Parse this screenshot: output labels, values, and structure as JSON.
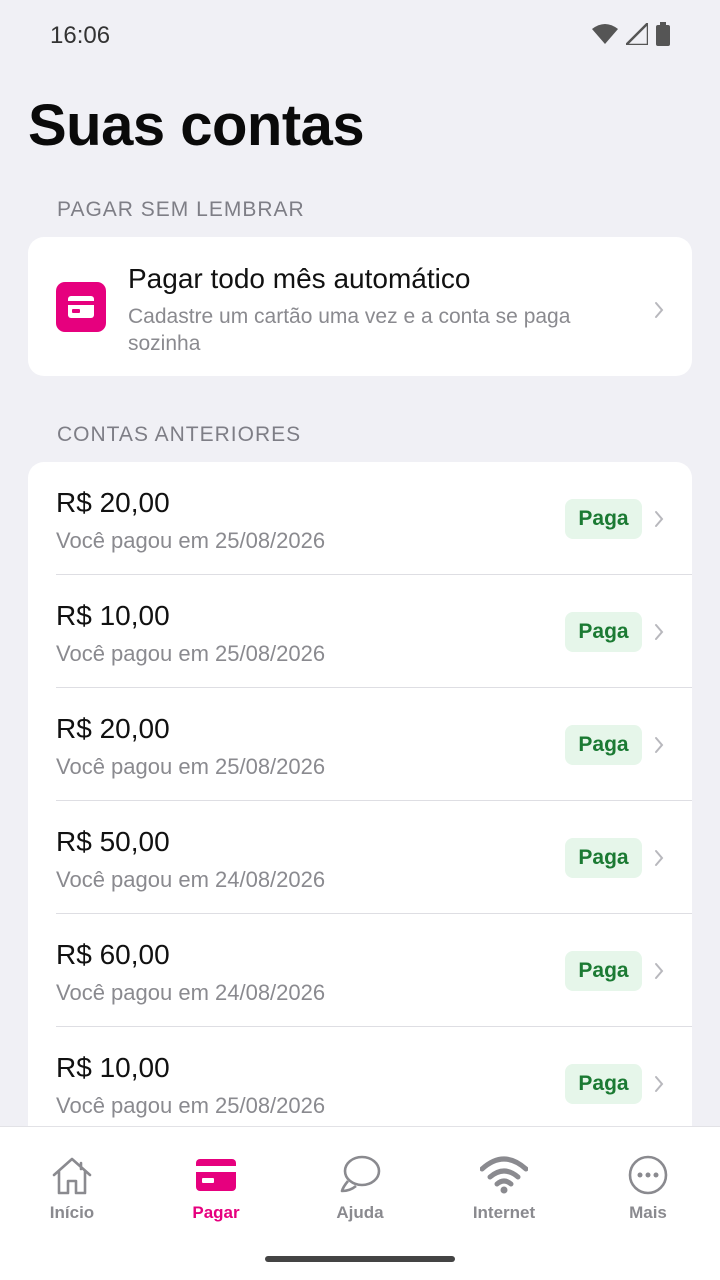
{
  "status_bar": {
    "time": "16:06"
  },
  "page": {
    "title": "Suas contas"
  },
  "autopay_section": {
    "label": "PAGAR SEM LEMBRAR",
    "card": {
      "title": "Pagar todo mês automático",
      "subtitle": "Cadastre um cartão uma vez e a conta se paga sozinha"
    }
  },
  "history_section": {
    "label": "CONTAS ANTERIORES",
    "bills": [
      {
        "amount": "R$ 20,00",
        "date": "Você pagou em 25/08/2026",
        "status": "Paga"
      },
      {
        "amount": "R$ 10,00",
        "date": "Você pagou em 25/08/2026",
        "status": "Paga"
      },
      {
        "amount": "R$ 20,00",
        "date": "Você pagou em 25/08/2026",
        "status": "Paga"
      },
      {
        "amount": "R$ 50,00",
        "date": "Você pagou em 24/08/2026",
        "status": "Paga"
      },
      {
        "amount": "R$ 60,00",
        "date": "Você pagou em 24/08/2026",
        "status": "Paga"
      },
      {
        "amount": "R$ 10,00",
        "date": "Você pagou em 25/08/2026",
        "status": "Paga"
      }
    ]
  },
  "bottom_nav": {
    "items": [
      {
        "label": "Início",
        "icon": "home-icon",
        "active": false
      },
      {
        "label": "Pagar",
        "icon": "card-icon",
        "active": true
      },
      {
        "label": "Ajuda",
        "icon": "chat-icon",
        "active": false
      },
      {
        "label": "Internet",
        "icon": "wifi-icon",
        "active": false
      },
      {
        "label": "Mais",
        "icon": "more-icon",
        "active": false
      }
    ]
  },
  "colors": {
    "accent": "#e6007e",
    "paid_badge_bg": "#e6f6ea",
    "paid_badge_text": "#1b7a33",
    "background": "#f0f0f5"
  }
}
